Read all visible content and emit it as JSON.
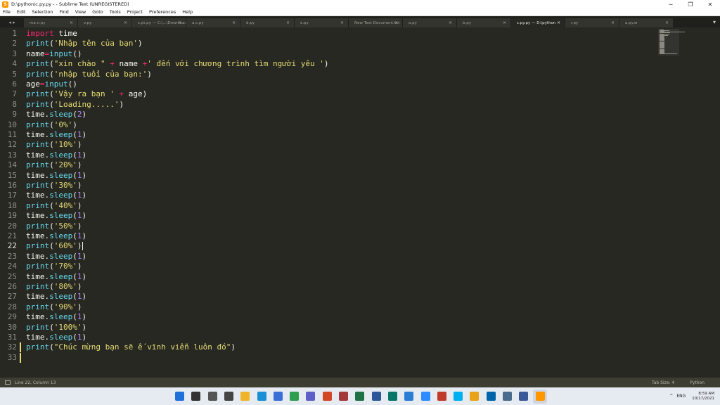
{
  "window": {
    "title": "D:\\python\\c.py.py - - Sublime Text (UNREGISTERED)",
    "minimize": "─",
    "maximize": "❐",
    "close": "✕"
  },
  "menu": [
    "File",
    "Edit",
    "Selection",
    "Find",
    "View",
    "Goto",
    "Tools",
    "Project",
    "Preferences",
    "Help"
  ],
  "tabs": [
    {
      "label": "ma.n.py",
      "active": false
    },
    {
      "label": "v.py",
      "active": false
    },
    {
      "label": "c.pt.py — C:\\...\\Downloads",
      "active": false
    },
    {
      "label": "a.c.py",
      "active": false
    },
    {
      "label": "d.py",
      "active": false
    },
    {
      "label": "e.py",
      "active": false
    },
    {
      "label": "New Text Document.txt",
      "active": false
    },
    {
      "label": "a.py",
      "active": false
    },
    {
      "label": "b.py",
      "active": false
    },
    {
      "label": "c.py.py — D:\\python",
      "active": true
    },
    {
      "label": "r.py",
      "active": false
    },
    {
      "label": "a.py.w",
      "active": false
    }
  ],
  "tab_nav": "◂ ▸",
  "tab_close": "×",
  "tab_dropdown": "▾",
  "editor": {
    "current_line": 22,
    "modified_from": 32,
    "lines": [
      [
        [
          "import",
          "kw"
        ],
        [
          " time",
          ""
        ]
      ],
      [
        [
          "print",
          "fn"
        ],
        [
          "(",
          ""
        ],
        [
          "'Nhập tên của bạn'",
          "str"
        ],
        [
          ")",
          ""
        ]
      ],
      [
        [
          "name",
          ""
        ],
        [
          "=",
          "op"
        ],
        [
          "input",
          "fn"
        ],
        [
          "()",
          ""
        ]
      ],
      [
        [
          "print",
          "fn"
        ],
        [
          "(",
          ""
        ],
        [
          "\"xin chào \"",
          "str"
        ],
        [
          " ",
          ""
        ],
        [
          "+",
          "op"
        ],
        [
          " name ",
          ""
        ],
        [
          "+",
          "op"
        ],
        [
          "' đến với chương trình tìm người yêu '",
          "str"
        ],
        [
          ")",
          ""
        ]
      ],
      [
        [
          "print",
          "fn"
        ],
        [
          "(",
          ""
        ],
        [
          "'nhập tuổi của bạn:'",
          "str"
        ],
        [
          ")",
          ""
        ]
      ],
      [
        [
          "age",
          ""
        ],
        [
          "=",
          "op"
        ],
        [
          "input",
          "fn"
        ],
        [
          "()",
          ""
        ]
      ],
      [
        [
          "print",
          "fn"
        ],
        [
          "(",
          ""
        ],
        [
          "'Vậy ra bạn '",
          "str"
        ],
        [
          " ",
          ""
        ],
        [
          "+",
          "op"
        ],
        [
          " age)",
          ""
        ]
      ],
      [
        [
          "print",
          "fn"
        ],
        [
          "(",
          ""
        ],
        [
          "'Loading.....'",
          "str"
        ],
        [
          ")",
          ""
        ]
      ],
      [
        [
          "time",
          ""
        ],
        [
          ".",
          ""
        ],
        [
          "sleep",
          "fn"
        ],
        [
          "(",
          ""
        ],
        [
          "2",
          "num"
        ],
        [
          ")",
          ""
        ]
      ],
      [
        [
          "print",
          "fn"
        ],
        [
          "(",
          ""
        ],
        [
          "'0%'",
          "str"
        ],
        [
          ")",
          ""
        ]
      ],
      [
        [
          "time",
          ""
        ],
        [
          ".",
          ""
        ],
        [
          "sleep",
          "fn"
        ],
        [
          "(",
          ""
        ],
        [
          "1",
          "num"
        ],
        [
          ")",
          ""
        ]
      ],
      [
        [
          "print",
          "fn"
        ],
        [
          "(",
          ""
        ],
        [
          "'10%'",
          "str"
        ],
        [
          ")",
          ""
        ]
      ],
      [
        [
          "time",
          ""
        ],
        [
          ".",
          ""
        ],
        [
          "sleep",
          "fn"
        ],
        [
          "(",
          ""
        ],
        [
          "1",
          "num"
        ],
        [
          ")",
          ""
        ]
      ],
      [
        [
          "print",
          "fn"
        ],
        [
          "(",
          ""
        ],
        [
          "'20%'",
          "str"
        ],
        [
          ")",
          ""
        ]
      ],
      [
        [
          "time",
          ""
        ],
        [
          ".",
          ""
        ],
        [
          "sleep",
          "fn"
        ],
        [
          "(",
          ""
        ],
        [
          "1",
          "num"
        ],
        [
          ")",
          ""
        ]
      ],
      [
        [
          "print",
          "fn"
        ],
        [
          "(",
          ""
        ],
        [
          "'30%'",
          "str"
        ],
        [
          ")",
          ""
        ]
      ],
      [
        [
          "time",
          ""
        ],
        [
          ".",
          ""
        ],
        [
          "sleep",
          "fn"
        ],
        [
          "(",
          ""
        ],
        [
          "1",
          "num"
        ],
        [
          ")",
          ""
        ]
      ],
      [
        [
          "print",
          "fn"
        ],
        [
          "(",
          ""
        ],
        [
          "'40%'",
          "str"
        ],
        [
          ")",
          ""
        ]
      ],
      [
        [
          "time",
          ""
        ],
        [
          ".",
          ""
        ],
        [
          "sleep",
          "fn"
        ],
        [
          "(",
          ""
        ],
        [
          "1",
          "num"
        ],
        [
          ")",
          ""
        ]
      ],
      [
        [
          "print",
          "fn"
        ],
        [
          "(",
          ""
        ],
        [
          "'50%'",
          "str"
        ],
        [
          ")",
          ""
        ]
      ],
      [
        [
          "time",
          ""
        ],
        [
          ".",
          ""
        ],
        [
          "sleep",
          "fn"
        ],
        [
          "(",
          ""
        ],
        [
          "1",
          "num"
        ],
        [
          ")",
          ""
        ]
      ],
      [
        [
          "print",
          "fn"
        ],
        [
          "(",
          ""
        ],
        [
          "'60%'",
          "str"
        ],
        [
          ")",
          ""
        ]
      ],
      [
        [
          "time",
          ""
        ],
        [
          ".",
          ""
        ],
        [
          "sleep",
          "fn"
        ],
        [
          "(",
          ""
        ],
        [
          "1",
          "num"
        ],
        [
          ")",
          ""
        ]
      ],
      [
        [
          "print",
          "fn"
        ],
        [
          "(",
          ""
        ],
        [
          "'70%'",
          "str"
        ],
        [
          ")",
          ""
        ]
      ],
      [
        [
          "time",
          ""
        ],
        [
          ".",
          ""
        ],
        [
          "sleep",
          "fn"
        ],
        [
          "(",
          ""
        ],
        [
          "1",
          "num"
        ],
        [
          ")",
          ""
        ]
      ],
      [
        [
          "print",
          "fn"
        ],
        [
          "(",
          ""
        ],
        [
          "'80%'",
          "str"
        ],
        [
          ")",
          ""
        ]
      ],
      [
        [
          "time",
          ""
        ],
        [
          ".",
          ""
        ],
        [
          "sleep",
          "fn"
        ],
        [
          "(",
          ""
        ],
        [
          "1",
          "num"
        ],
        [
          ")",
          ""
        ]
      ],
      [
        [
          "print",
          "fn"
        ],
        [
          "(",
          ""
        ],
        [
          "'90%'",
          "str"
        ],
        [
          ")",
          ""
        ]
      ],
      [
        [
          "time",
          ""
        ],
        [
          ".",
          ""
        ],
        [
          "sleep",
          "fn"
        ],
        [
          "(",
          ""
        ],
        [
          "1",
          "num"
        ],
        [
          ")",
          ""
        ]
      ],
      [
        [
          "print",
          "fn"
        ],
        [
          "(",
          ""
        ],
        [
          "'100%'",
          "str"
        ],
        [
          ")",
          ""
        ]
      ],
      [
        [
          "time",
          ""
        ],
        [
          ".",
          ""
        ],
        [
          "sleep",
          "fn"
        ],
        [
          "(",
          ""
        ],
        [
          "1",
          "num"
        ],
        [
          ")",
          ""
        ]
      ],
      [
        [
          "print",
          "fn"
        ],
        [
          "(",
          ""
        ],
        [
          "\"Chúc mừng bạn sẽ ế vĩnh viễn luôn đó\"",
          "str"
        ],
        [
          ")",
          ""
        ]
      ],
      []
    ]
  },
  "statusbar": {
    "position": "Line 22, Column 13",
    "tab_size": "Tab Size: 4",
    "syntax": "Python"
  },
  "taskbar": {
    "icons": [
      {
        "name": "start-icon",
        "color": "#1e6fd9"
      },
      {
        "name": "search-icon",
        "color": "#333333"
      },
      {
        "name": "task-view-icon",
        "color": "#555555"
      },
      {
        "name": "calculator-icon",
        "color": "#444444"
      },
      {
        "name": "file-explorer-icon",
        "color": "#f0b429"
      },
      {
        "name": "edge-icon",
        "color": "#1b8fd6"
      },
      {
        "name": "store-icon",
        "color": "#3a6fd8"
      },
      {
        "name": "chrome-green-icon",
        "color": "#2e9e4f"
      },
      {
        "name": "teams-icon",
        "color": "#5b5fc7"
      },
      {
        "name": "powerpoint-icon",
        "color": "#d24726"
      },
      {
        "name": "access-icon",
        "color": "#a4373a"
      },
      {
        "name": "excel-icon",
        "color": "#1e7145"
      },
      {
        "name": "word-icon",
        "color": "#2b579a"
      },
      {
        "name": "publisher-icon",
        "color": "#077568"
      },
      {
        "name": "photos-icon",
        "color": "#2b7cd3"
      },
      {
        "name": "zoom-icon",
        "color": "#2d8cff"
      },
      {
        "name": "record-icon",
        "color": "#c0392b"
      },
      {
        "name": "skype-icon",
        "color": "#00aff0"
      },
      {
        "name": "chrome-icon",
        "color": "#e8a317"
      },
      {
        "name": "vscode-icon",
        "color": "#0065a9"
      },
      {
        "name": "image-viewer-icon",
        "color": "#4a6c8c"
      },
      {
        "name": "movies-icon",
        "color": "#3b5998"
      },
      {
        "name": "sublime-icon",
        "color": "#ff9800"
      }
    ],
    "tray": {
      "chevron": "^",
      "language": "ENG",
      "time": "8:59 AM",
      "date": "10/17/2021"
    }
  }
}
